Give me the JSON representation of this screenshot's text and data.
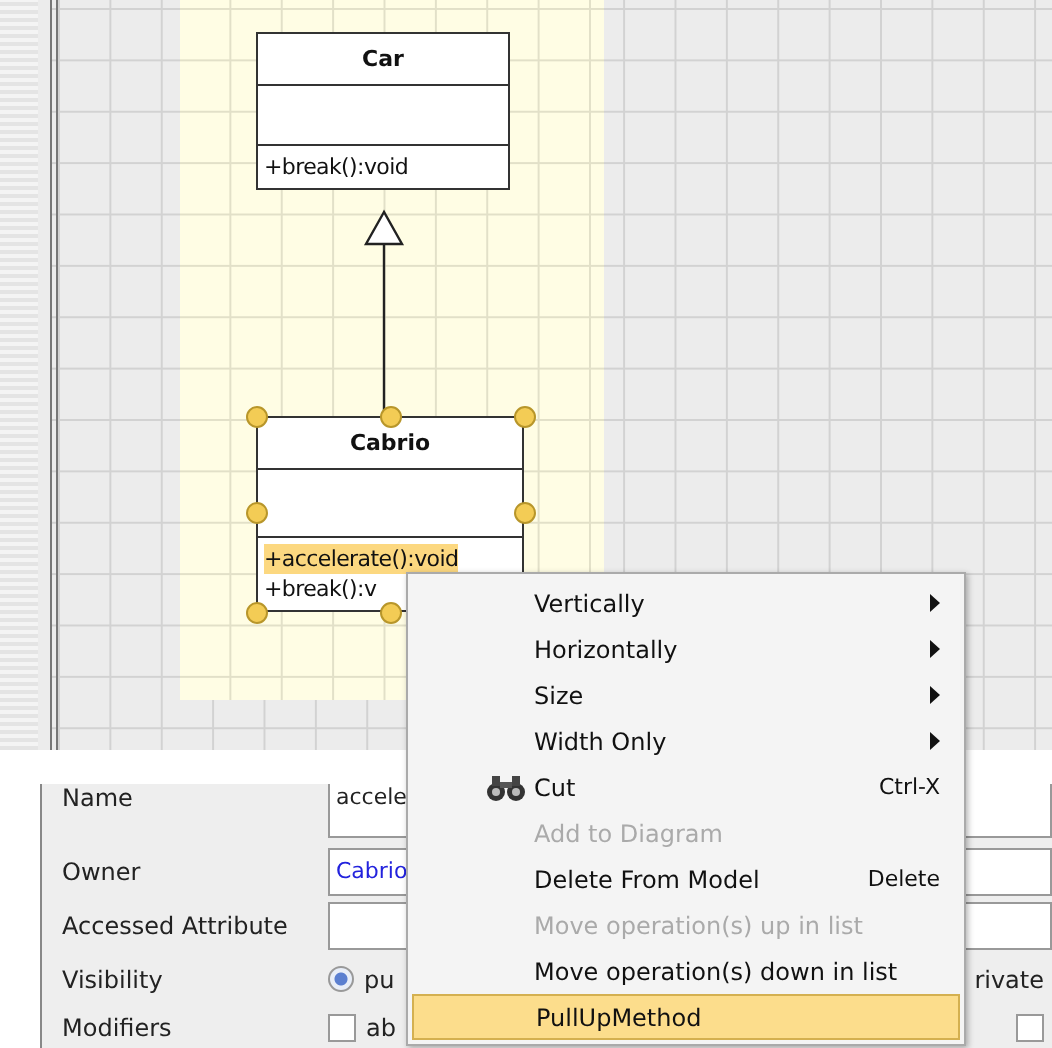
{
  "diagram": {
    "classes": [
      {
        "name": "Car",
        "selected": false,
        "operations": [
          {
            "text": "+break():void",
            "selected": false
          }
        ]
      },
      {
        "name": "Cabrio",
        "selected": true,
        "operations": [
          {
            "text": "+accelerate():void",
            "selected": true
          },
          {
            "text": "+break():v",
            "selected": false
          }
        ]
      }
    ]
  },
  "properties": {
    "rows": [
      {
        "kind": "field",
        "label": "Name",
        "value": "accele"
      },
      {
        "kind": "link-field",
        "label": "Owner",
        "value": "Cabrio"
      },
      {
        "kind": "field",
        "label": "Accessed Attribute",
        "value": ""
      },
      {
        "kind": "radios",
        "label": "Visibility",
        "left": {
          "label": "pu",
          "selected": true
        },
        "right_text": "rivate"
      },
      {
        "kind": "checks",
        "label": "Modifiers",
        "left": {
          "label": "ab",
          "checked": false
        },
        "right": {
          "checked": false
        }
      }
    ]
  },
  "context_menu": {
    "items": [
      {
        "kind": "submenu",
        "label": "Vertically",
        "disabled": false,
        "selected": false
      },
      {
        "kind": "submenu",
        "label": "Horizontally",
        "disabled": false,
        "selected": false
      },
      {
        "kind": "submenu",
        "label": "Size",
        "disabled": false,
        "selected": false
      },
      {
        "kind": "submenu",
        "label": "Width Only",
        "disabled": false,
        "selected": false
      },
      {
        "kind": "icon-action",
        "label": "Cut",
        "shortcut": "Ctrl-X",
        "disabled": false,
        "selected": false
      },
      {
        "kind": "action",
        "label": "Add to Diagram",
        "disabled": true,
        "selected": false
      },
      {
        "kind": "action",
        "label": "Delete From Model",
        "shortcut": "Delete",
        "disabled": false,
        "selected": false
      },
      {
        "kind": "action",
        "label": "Move operation(s) up in list",
        "disabled": true,
        "selected": false
      },
      {
        "kind": "action",
        "label": "Move operation(s) down in list",
        "disabled": false,
        "selected": false
      },
      {
        "kind": "action",
        "label": "PullUpMethod",
        "disabled": false,
        "selected": true
      }
    ]
  }
}
